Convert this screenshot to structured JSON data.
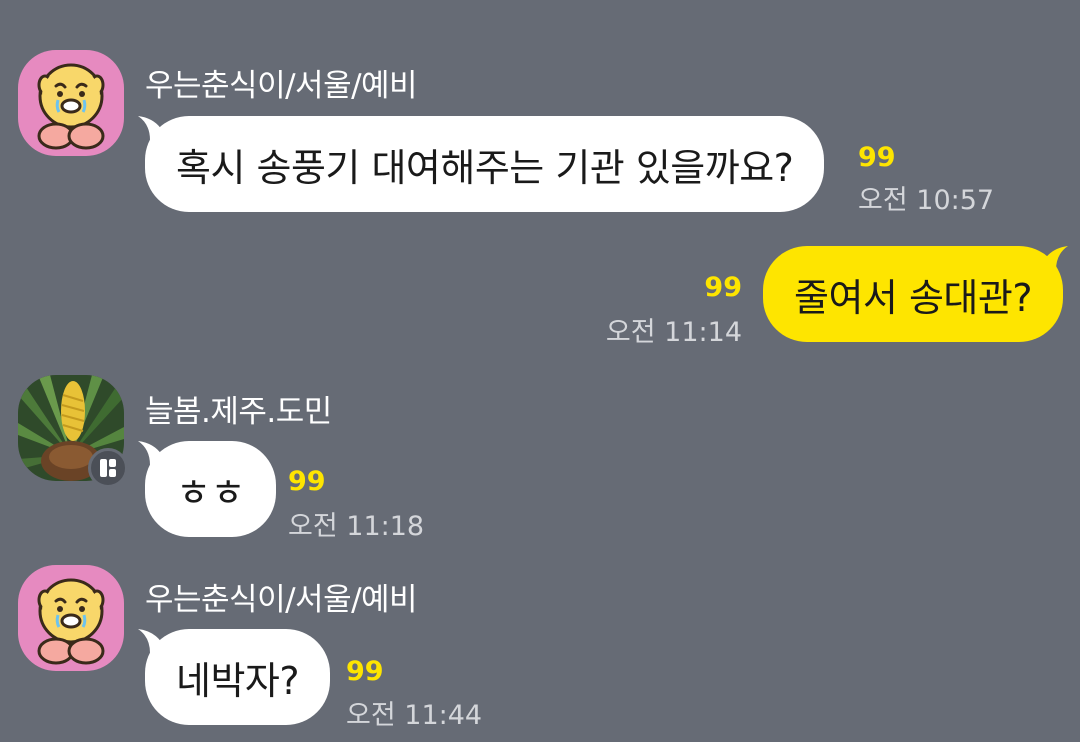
{
  "messages": [
    {
      "sender": "우는춘식이/서울/예비",
      "text": "혹시 송풍기 대여해주는 기관 있을까요?",
      "count": "99",
      "time": "오전 10:57",
      "direction": "incoming",
      "avatar_icon": "crying-character-avatar-icon"
    },
    {
      "text": "줄여서 송대관?",
      "count": "99",
      "time": "오전 11:14",
      "direction": "outgoing"
    },
    {
      "sender": "늘봄.제주.도민",
      "text": "ㅎㅎ",
      "count": "99",
      "time": "오전 11:18",
      "direction": "incoming",
      "avatar_icon": "palm-plant-photo-avatar-icon",
      "badge_icon": "multi-profile-badge-icon"
    },
    {
      "sender": "우는춘식이/서울/예비",
      "text": "네박자?",
      "count": "99",
      "time": "오전 11:44",
      "direction": "incoming",
      "avatar_icon": "crying-character-avatar-icon"
    }
  ],
  "colors": {
    "background": "#666b75",
    "incoming_bubble": "#ffffff",
    "outgoing_bubble": "#fee500",
    "unread_count": "#fee500",
    "sender_text": "#ffffff",
    "time_text": "#d4d6da"
  }
}
